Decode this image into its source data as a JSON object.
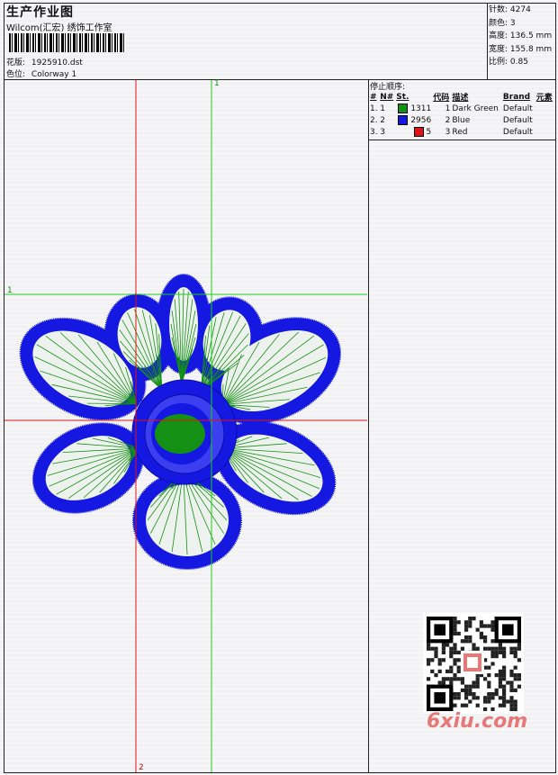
{
  "header": {
    "title": "生产作业图",
    "company": "Wilcom(汇宏) 绣饰工作室",
    "design_label": "花版:",
    "design_file": "1925910.dst",
    "colorway_label": "色位:",
    "colorway": "Colorway 1"
  },
  "stats": {
    "stitches_label": "针数:",
    "stitches": "4274",
    "colors_label": "颜色:",
    "colors": "3",
    "height_label": "高度:",
    "height": "136.5 mm",
    "width_label": "宽度:",
    "width": "155.8 mm",
    "scale_label": "比例:",
    "scale": "0.85"
  },
  "stop_sequence": {
    "title": "停止顺序:",
    "columns": [
      "#",
      "N#",
      "St.",
      "代码",
      "描述",
      "Brand",
      "元素"
    ],
    "rows": [
      {
        "index": "1.",
        "n": "1",
        "color": "#149014",
        "stitches": "1311",
        "code": "1",
        "desc": "Dark Green",
        "brand": "Default"
      },
      {
        "index": "2.",
        "n": "2",
        "color": "#1418e0",
        "stitches": "2956",
        "code": "2",
        "desc": "Blue",
        "brand": "Default"
      },
      {
        "index": "3.",
        "n": "3",
        "color": "#e01414",
        "stitches": "5",
        "code": "3",
        "desc": "Red",
        "brand": "Default"
      }
    ]
  },
  "guides": {
    "green_v_label": "1",
    "green_h_label": "1",
    "red_v_label": "2"
  },
  "watermark": "6xiu.com",
  "palette": {
    "green": "#149014",
    "blue": "#1418e0",
    "red": "#e01414"
  }
}
